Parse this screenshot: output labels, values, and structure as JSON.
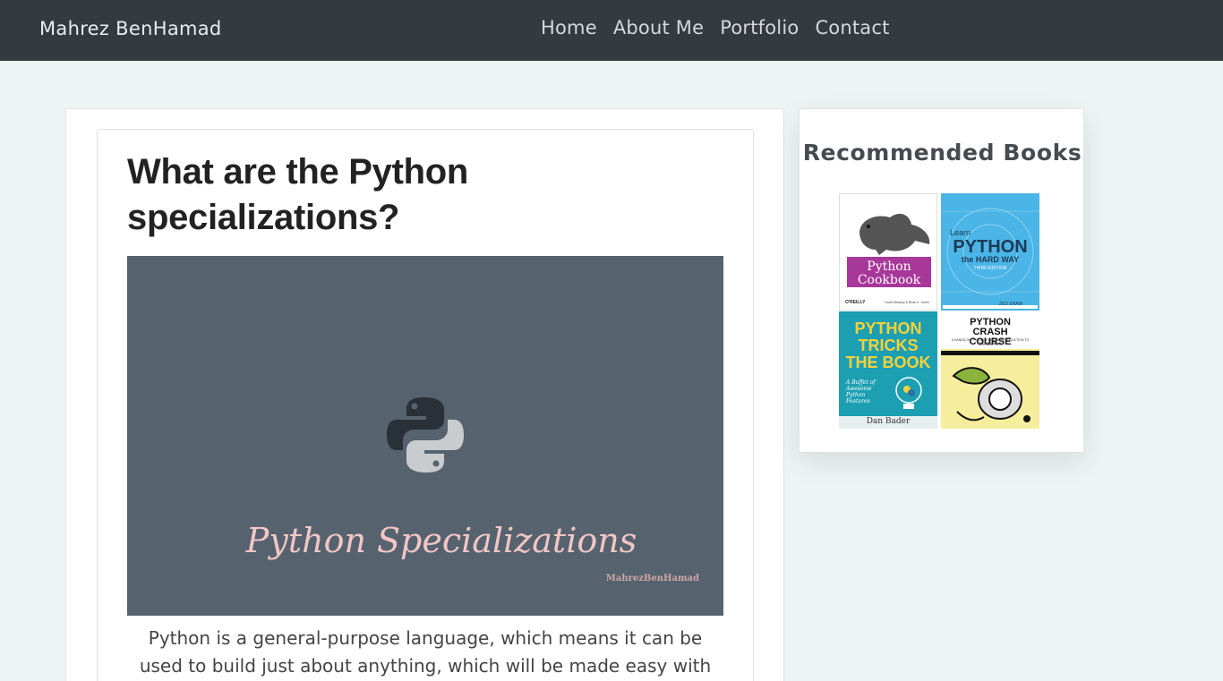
{
  "nav": {
    "brand": "Mahrez BenHamad",
    "items": [
      {
        "label": "Home"
      },
      {
        "label": "About Me"
      },
      {
        "label": "Portfolio"
      },
      {
        "label": "Contact"
      }
    ]
  },
  "post": {
    "title": "What are the Python specializations?",
    "image": {
      "caption": "Python Specializations",
      "watermark": "MahrezBenHamad"
    },
    "intro": "Python is a general-purpose language, which means it can be used to build just about anything, which will be made easy with the right"
  },
  "sidebar": {
    "title": "Recommended Books",
    "books": [
      {
        "cover": "Python Cookbook",
        "publisher": "O'REILLY",
        "authors": "David Beazley & Brian K. Jones"
      },
      {
        "cover_top": "Learn",
        "cover_main": "PYTHON",
        "cover_sub": "the HARD WAY",
        "edition": "THIRD EDITION",
        "author": "ZED SHAW"
      },
      {
        "cover": "PYTHON TRICKS THE BOOK",
        "tagline": "A Buffet of Awesome Python Features",
        "author": "Dan Bader"
      },
      {
        "cover": "PYTHON CRASH COURSE",
        "tagline": "A HANDS-ON, PROJECT-BASED INTRODUCTION TO PROGRAMMING",
        "author": "ERIC MATTHES"
      }
    ]
  },
  "colors": {
    "navbar": "#343a40",
    "page_bg": "#eef4f4",
    "image_bg": "#56636f",
    "caption": "#f1c6c6"
  }
}
